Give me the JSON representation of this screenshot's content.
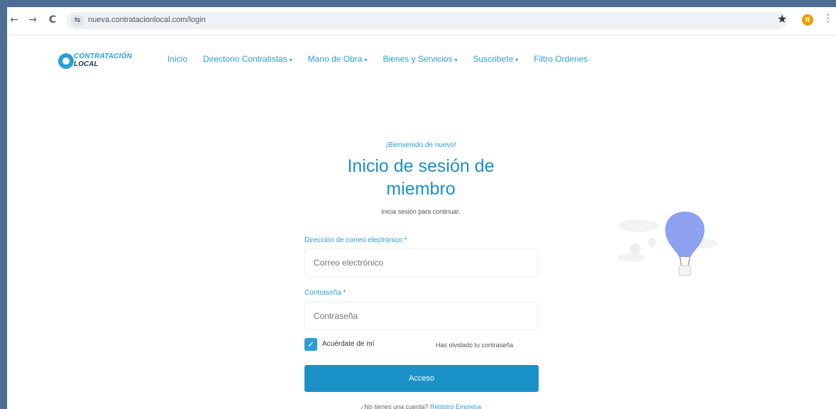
{
  "browser": {
    "back": "←",
    "forward": "→",
    "reload": "C",
    "site_info": "⇆",
    "url": "nueva.contratacionlocal.com/login",
    "bookmark": "★",
    "profile_initial": "R",
    "menu": "⋮"
  },
  "logo": {
    "line1": "CONTRATACIÓN",
    "line2": "LOCAL"
  },
  "nav": {
    "inicio": "Inicio",
    "directorio": "Directorio Contratistas",
    "mano_de_obra": "Mano de Obra",
    "bienes": "Bienes y Servicios",
    "suscribete": "Suscribete",
    "filtro": "Filtro Ordenes",
    "caret": "▾"
  },
  "login": {
    "welcome": "¡Bienvenido de nuevo!",
    "title": "Inicio de sesión de miembro",
    "subtitle": "Inicia sesión para continuar.",
    "email_label": "Dirección de correo electrónico *",
    "email_placeholder": "Correo electrónico",
    "password_label": "Contraseña *",
    "password_placeholder": "Contraseña",
    "remember_checked_mark": "✓",
    "remember_label": "Acuérdate de mí",
    "forgot": "Has olvidado tu contraseña",
    "submit": "Acceso",
    "no_account": "¿No tienes una cuenta?",
    "register": "Registro Empresa"
  },
  "colors": {
    "accent": "#2a9fd6",
    "button": "#1a92c8",
    "balloon": "#8da1f0",
    "background_frame": "#4e6d94"
  }
}
